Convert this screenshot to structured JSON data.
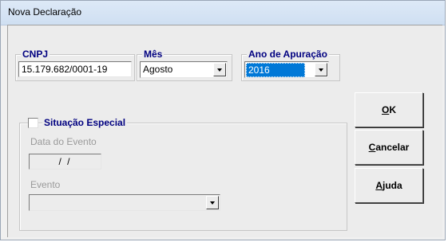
{
  "window": {
    "title": "Nova Declaração"
  },
  "cnpj": {
    "legend": "CNPJ",
    "value": "15.179.682/0001-19"
  },
  "mes": {
    "legend": "Mês",
    "value": "Agosto"
  },
  "ano": {
    "legend": "Ano de Apuração",
    "value": "2016"
  },
  "situacao": {
    "legend": "Situação Especial",
    "checked": false,
    "data_label": "Data do Evento",
    "data_value": "/ /",
    "evento_label": "Evento",
    "evento_value": ""
  },
  "buttons": {
    "ok": {
      "mnemonic": "O",
      "rest": "K"
    },
    "cancelar": {
      "mnemonic": "C",
      "rest": "ancelar"
    },
    "ajuda": {
      "mnemonic": "A",
      "rest": "juda"
    }
  },
  "colors": {
    "legend": "#000080",
    "selection": "#0078d7"
  }
}
